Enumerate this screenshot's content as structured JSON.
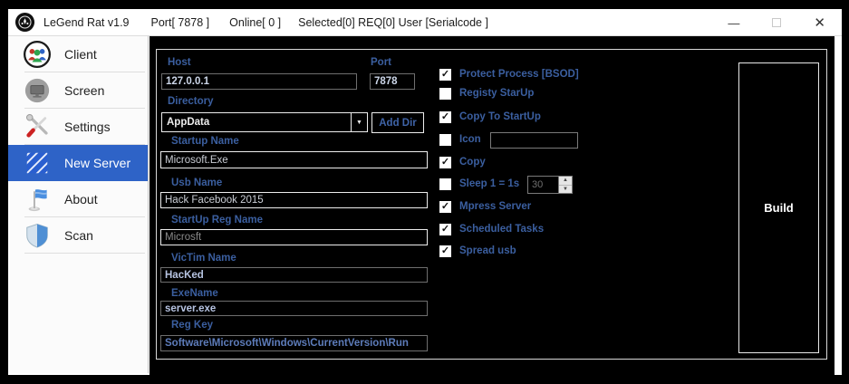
{
  "titlebar": {
    "app_title": "LeGend Rat v1.9",
    "port": "Port[ 7878 ]",
    "online": "Online[ 0 ]",
    "status": "Selected[0] REQ[0] User [Serialcode ]",
    "minimize_glyph": "—",
    "close_glyph": "✕"
  },
  "sidebar": {
    "items": [
      {
        "label": "Client",
        "icon": "people-icon",
        "active": false
      },
      {
        "label": "Screen",
        "icon": "monitor-icon",
        "active": false
      },
      {
        "label": "Settings",
        "icon": "tools-icon",
        "active": false
      },
      {
        "label": "New Server",
        "icon": "hatched-box-icon",
        "active": true
      },
      {
        "label": "About",
        "icon": "flag-icon",
        "active": false
      },
      {
        "label": "Scan",
        "icon": "shield-icon",
        "active": false
      }
    ]
  },
  "form": {
    "host": {
      "label": "Host",
      "value": "127.0.0.1"
    },
    "port": {
      "label": "Port",
      "value": "7878"
    },
    "directory": {
      "label": "Directory",
      "value": "AppData",
      "arrow_glyph": "▼",
      "add_button": "Add Dir"
    },
    "startup_name": {
      "label": "Startup Name",
      "value": "Microsoft.Exe"
    },
    "usb_name": {
      "label": "Usb Name",
      "value": "Hack Facebook 2015"
    },
    "startup_reg_name": {
      "label": "StartUp Reg Name",
      "placeholder": "Microsft"
    },
    "victim_name": {
      "label": "VicTim Name",
      "value": "HacKed"
    },
    "exe_name": {
      "label": "ExeName",
      "value": "server.exe"
    },
    "reg_key": {
      "label": "Reg Key",
      "value": "Software\\Microsoft\\Windows\\CurrentVersion\\Run"
    }
  },
  "options": {
    "check_glyph": "✓",
    "spinner_up_glyph": "▲",
    "spinner_down_glyph": "▼",
    "items": [
      {
        "label": "Protect Process [BSOD]",
        "checked": true
      },
      {
        "label": "Registy StarUp",
        "checked": false
      },
      {
        "label": "Copy To StartUp",
        "checked": true
      },
      {
        "label": "Icon",
        "checked": false
      },
      {
        "label": "Copy",
        "checked": true
      },
      {
        "label": "Sleep 1 = 1s",
        "checked": false
      },
      {
        "label": "Mpress Server",
        "checked": true
      },
      {
        "label": "Scheduled Tasks",
        "checked": true
      },
      {
        "label": "Spread usb",
        "checked": true
      }
    ],
    "icon_textbox_value": "",
    "sleep_value": "30"
  },
  "build": {
    "label": "Build"
  },
  "colors": {
    "accent_blue": "#3b5fa0",
    "highlight_blue": "#2e63c7",
    "panel_black": "#000000",
    "frame_white": "#ffffff"
  }
}
